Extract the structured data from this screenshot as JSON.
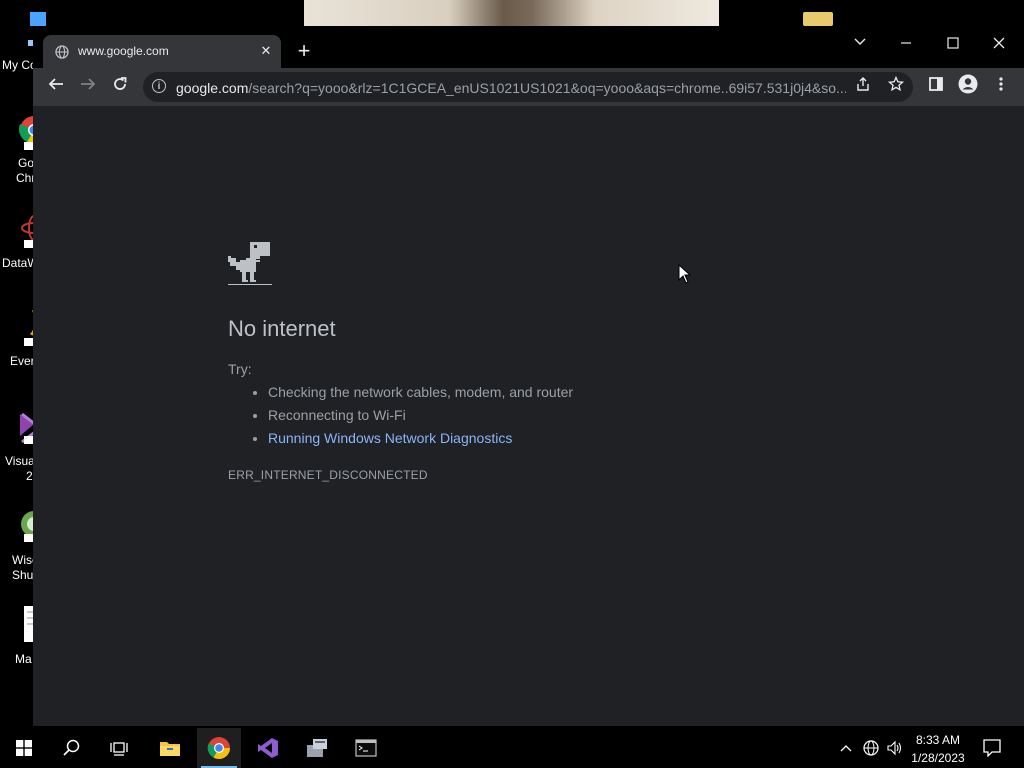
{
  "desktop": {
    "icons": [
      {
        "label": "My Co",
        "icon": "computer-icon"
      },
      {
        "label": "Go",
        "label2": "Chr",
        "icon": "chrome-icon"
      },
      {
        "label": "DataW",
        "icon": "datawrapper-icon"
      },
      {
        "label": "Ever",
        "icon": "evernote-icon"
      },
      {
        "label": "Visua",
        "label2": "2",
        "icon": "visual-studio-icon"
      },
      {
        "label": "Wise",
        "label2": "Shut",
        "icon": "wise-shutdown-icon"
      },
      {
        "label": "Ma",
        "icon": "document-icon"
      }
    ]
  },
  "browser": {
    "tab": {
      "title": "www.google.com",
      "favicon": "globe-icon"
    },
    "new_tab_symbol": "+",
    "omnibox": {
      "host": "google.com",
      "path": "/search?q=yooo&rlz=1C1GCEA_enUS1021US1021&oq=yooo&aqs=chrome..69i57.531j0j4&so..."
    }
  },
  "error_page": {
    "heading": "No internet",
    "try_label": "Try:",
    "suggestions": [
      "Checking the network cables, modem, and router",
      "Reconnecting to Wi-Fi",
      "Running Windows Network Diagnostics"
    ],
    "error_code": "ERR_INTERNET_DISCONNECTED"
  },
  "taskbar": {
    "apps": [
      "windows-start-icon",
      "search-icon",
      "task-view-icon",
      "file-explorer-icon",
      "chrome-icon",
      "visual-studio-icon",
      "app-icon",
      "terminal-icon"
    ],
    "active_app": "chrome-icon",
    "time": "8:33 AM",
    "date": "1/28/2023"
  },
  "colors": {
    "page_bg": "#202124",
    "toolbar_bg": "#35363a",
    "link": "#8ab4f8",
    "text_secondary": "#9aa0a6"
  }
}
